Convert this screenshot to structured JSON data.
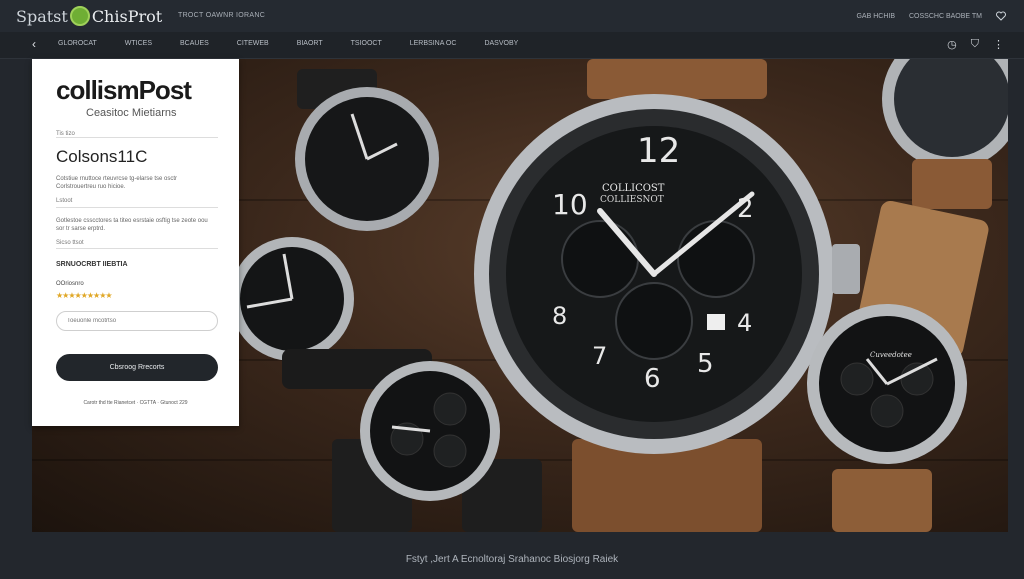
{
  "header": {
    "brand_left": "Spatst",
    "brand_right": "ChisProt",
    "meta": "TROCT OAWNR IORANC",
    "right_text_1": "GAB HCHIB",
    "right_text_2": "COSSCHC BAOBE TM"
  },
  "nav": {
    "items": [
      "GLOROCAT",
      "WTICES",
      "BCAUES",
      "CITEWEB",
      "BIAORT",
      "TSIOOCT",
      "LERBSINA OC",
      "DASVOBY"
    ]
  },
  "panel": {
    "logo": "collismPost",
    "tagline": "Ceasitoc Mietiarns",
    "label_1": "Tis tizo",
    "title": "Colsons11C",
    "desc_1": "Cotstiue rnuttoce rteuvrcse tg-elarse tse osctr Corlstrouertreu ruo hicioe.",
    "label_2": "Lstoot",
    "desc_2": "Gotlestoe csscctores ta titeo esrstaie osftig tse zeote oou sor tr sarse erptrd.",
    "label_3": "Sicso ttsot",
    "promo": "SRNUOCRBT IIEBTIA",
    "rating_label": "OOriosnro",
    "stars": "★★★★★★★★★",
    "input_placeholder": "Toeuonle mcotrtso",
    "cta": "Cbsroog Rrecorts",
    "fine_print": "Carotr thd tte Rianetcet · CGTTA · Gtunoct 229"
  },
  "hero": {
    "main_brand_1": "COLLICOST",
    "main_brand_2": "COLLIESNOT",
    "small_watch_brand": "Cuveedotee"
  },
  "footer": {
    "caption": "Fstyt ,Jert A Ecnoltoraj Srahanoc Biosjorg Raiek"
  },
  "colors": {
    "accent": "#6fae34",
    "dark": "#22262b",
    "panel": "#ffffff"
  }
}
